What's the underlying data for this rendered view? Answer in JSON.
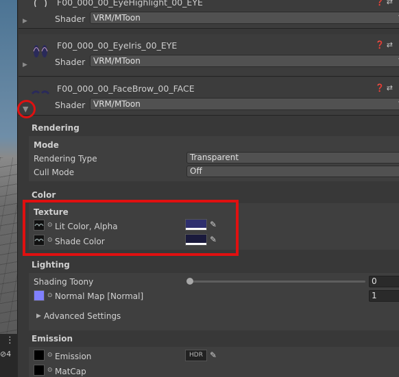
{
  "scene_strip": {
    "menu_icon_glyph": "⋮",
    "visibility_count": "4"
  },
  "materials": [
    {
      "name": "F00_000_00_EyeHighlight_00_EYE",
      "shader_label": "Shader",
      "shader_value": "VRM/MToon"
    },
    {
      "name": "F00_000_00_EyeIris_00_EYE",
      "shader_label": "Shader",
      "shader_value": "VRM/MToon"
    },
    {
      "name": "F00_000_00_FaceBrow_00_FACE",
      "shader_label": "Shader",
      "shader_value": "VRM/MToon"
    }
  ],
  "rendering": {
    "title": "Rendering",
    "mode_title": "Mode",
    "rendering_type_label": "Rendering Type",
    "rendering_type_value": "Transparent",
    "cull_mode_label": "Cull Mode",
    "cull_mode_value": "Off"
  },
  "color": {
    "title": "Color",
    "texture_title": "Texture",
    "lit_color_label": "Lit Color, Alpha",
    "lit_color_hex": "#2e2f6e",
    "shade_color_label": "Shade Color",
    "shade_color_hex": "#1a1a3c"
  },
  "lighting": {
    "title": "Lighting",
    "shading_toony_label": "Shading Toony",
    "shading_toony_value": "0",
    "normal_map_label": "Normal Map [Normal]",
    "normal_map_value": "1",
    "advanced_label": "Advanced Settings"
  },
  "emission": {
    "title": "Emission",
    "emission_label": "Emission",
    "hdr_label": "HDR",
    "matcap_label": "MatCap"
  },
  "colors": {
    "highlight_red": "#e01010",
    "normal_map_slot": "#8080ff"
  }
}
